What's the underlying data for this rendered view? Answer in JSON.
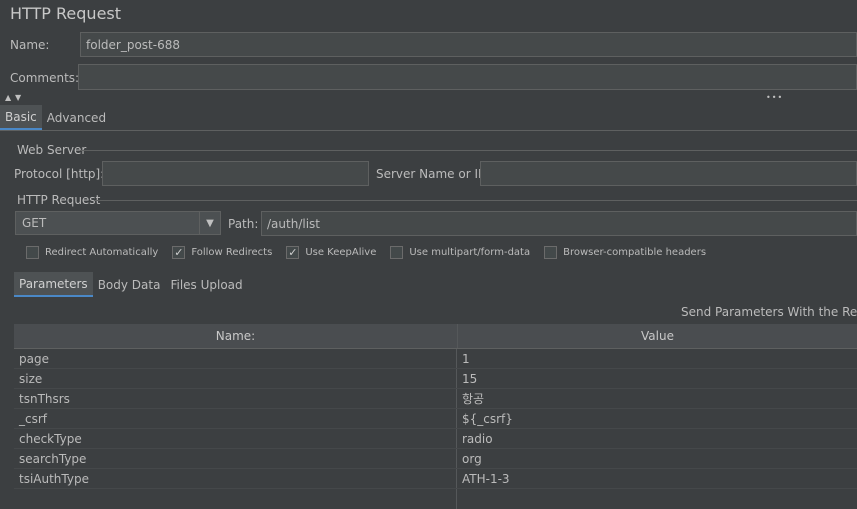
{
  "title": "HTTP Request",
  "name_label": "Name:",
  "name_value": "folder_post-688",
  "comments_label": "Comments:",
  "comments_value": "",
  "tabs_top": [
    "Basic",
    "Advanced"
  ],
  "web_server": {
    "legend": "Web Server",
    "protocol_label": "Protocol [http]:",
    "protocol_value": "",
    "server_label": "Server Name or IP:",
    "server_value": ""
  },
  "http_request": {
    "legend": "HTTP Request",
    "method": "GET",
    "path_label": "Path:",
    "path_value": "/auth/list"
  },
  "checkboxes": [
    {
      "label": "Redirect Automatically",
      "checked": false
    },
    {
      "label": "Follow Redirects",
      "checked": true
    },
    {
      "label": "Use KeepAlive",
      "checked": true
    },
    {
      "label": "Use multipart/form-data",
      "checked": false
    },
    {
      "label": "Browser-compatible headers",
      "checked": false
    }
  ],
  "sub_tabs": [
    "Parameters",
    "Body Data",
    "Files Upload"
  ],
  "send_params_label": "Send Parameters With the Reques",
  "table": {
    "headers": [
      "Name:",
      "Value"
    ],
    "rows": [
      [
        "page",
        "1"
      ],
      [
        "size",
        "15"
      ],
      [
        "tsnThsrs",
        "항공"
      ],
      [
        "_csrf",
        "${_csrf}"
      ],
      [
        "checkType",
        "radio"
      ],
      [
        "searchType",
        "org"
      ],
      [
        "tsiAuthType",
        "ATH-1-3"
      ]
    ]
  },
  "colors": {
    "background": "#3c3f41",
    "accent": "#4a88c7",
    "field": "#45494a"
  }
}
